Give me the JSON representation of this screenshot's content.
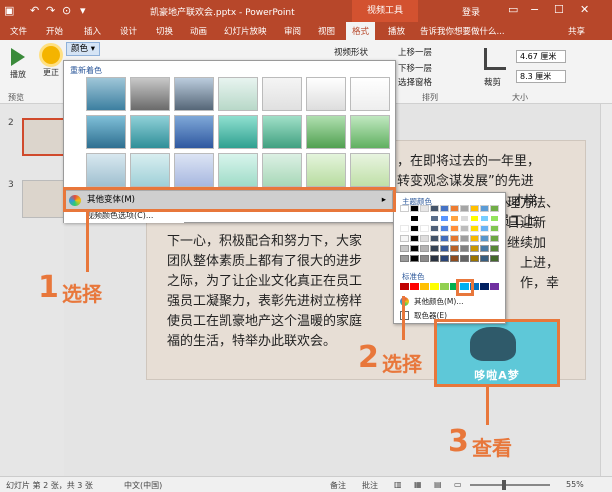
{
  "titlebar": {
    "document_title": "凯豪地产联欢会.pptx - PowerPoint",
    "context_tab": "视频工具",
    "login": "登录",
    "quick_access": [
      "↶",
      "↷",
      "⊙"
    ]
  },
  "tabs": [
    {
      "label": "文件"
    },
    {
      "label": "开始"
    },
    {
      "label": "插入"
    },
    {
      "label": "设计"
    },
    {
      "label": "切换"
    },
    {
      "label": "动画"
    },
    {
      "label": "幻灯片放映"
    },
    {
      "label": "审阅"
    },
    {
      "label": "视图"
    },
    {
      "label": "格式"
    },
    {
      "label": "播放"
    }
  ],
  "active_tab": "格式",
  "tell_me": "告诉我你想要做什么...",
  "share": "共享",
  "ribbon": {
    "play_label": "播放",
    "change_label": "更正",
    "color_label": "颜色",
    "preview_group": "预览",
    "video_shape": "视频形状",
    "bring_forward": "上移一层",
    "send_backward": "下移一层",
    "selection_pane": "选择窗格",
    "arrange_group": "排列",
    "crop_label": "裁剪",
    "size_group": "大小",
    "height_value": "4.67 厘米",
    "width_value": "8.3 厘米"
  },
  "gallery": {
    "heading": "重新着色",
    "menu_more": "其他变体(M)",
    "menu_set": "视频颜色选项(C)..."
  },
  "palette": {
    "theme_heading": "主题颜色",
    "standard_heading": "标准色",
    "more_colors": "其他颜色(M)...",
    "eyedropper": "取色器(E)",
    "theme_colors": [
      "#ffffff",
      "#000000",
      "#e7e6e6",
      "#44546a",
      "#4472c4",
      "#ed7d31",
      "#a5a5a5",
      "#ffc000",
      "#5b9bd5",
      "#70ad47"
    ],
    "standard_colors": [
      "#c00000",
      "#ff0000",
      "#ffc000",
      "#ffff00",
      "#92d050",
      "#00b050",
      "#00b0f0",
      "#0070c0",
      "#002060",
      "#7030a0"
    ]
  },
  "slide": {
    "lines": [
      "，在即将过去的一年里，",
      "转变观念谋发展”的先进",
      "大人才梯",
      "员工上",
      "下一心，积极配合和努力下，大家",
      "理方法、",
      "团队整体素质上都有了很大的进步",
      "日迎新",
      "之际，为了让企业文化真正在员工",
      "继续加",
      "强员工凝聚力，表彰先进树立榜样",
      "上进，",
      "使员工在凯豪地产这个温暖的家庭",
      "作，幸",
      "福的生活，特举办此联欢会。"
    ],
    "picture_caption": "哆啦A梦"
  },
  "thumbnails": [
    {
      "number": "2"
    },
    {
      "number": "3"
    }
  ],
  "annotations": {
    "step1_num": "1",
    "step1_word": "选择",
    "step2_num": "2",
    "step2_word": "选择",
    "step3_num": "3",
    "step3_word": "查看",
    "accent_color": "#e8773b"
  },
  "status": {
    "slide_count": "幻灯片 第 2 张，共 3 张",
    "language": "中文(中国)",
    "notes": "备注",
    "comments": "批注",
    "zoom": "55%"
  }
}
